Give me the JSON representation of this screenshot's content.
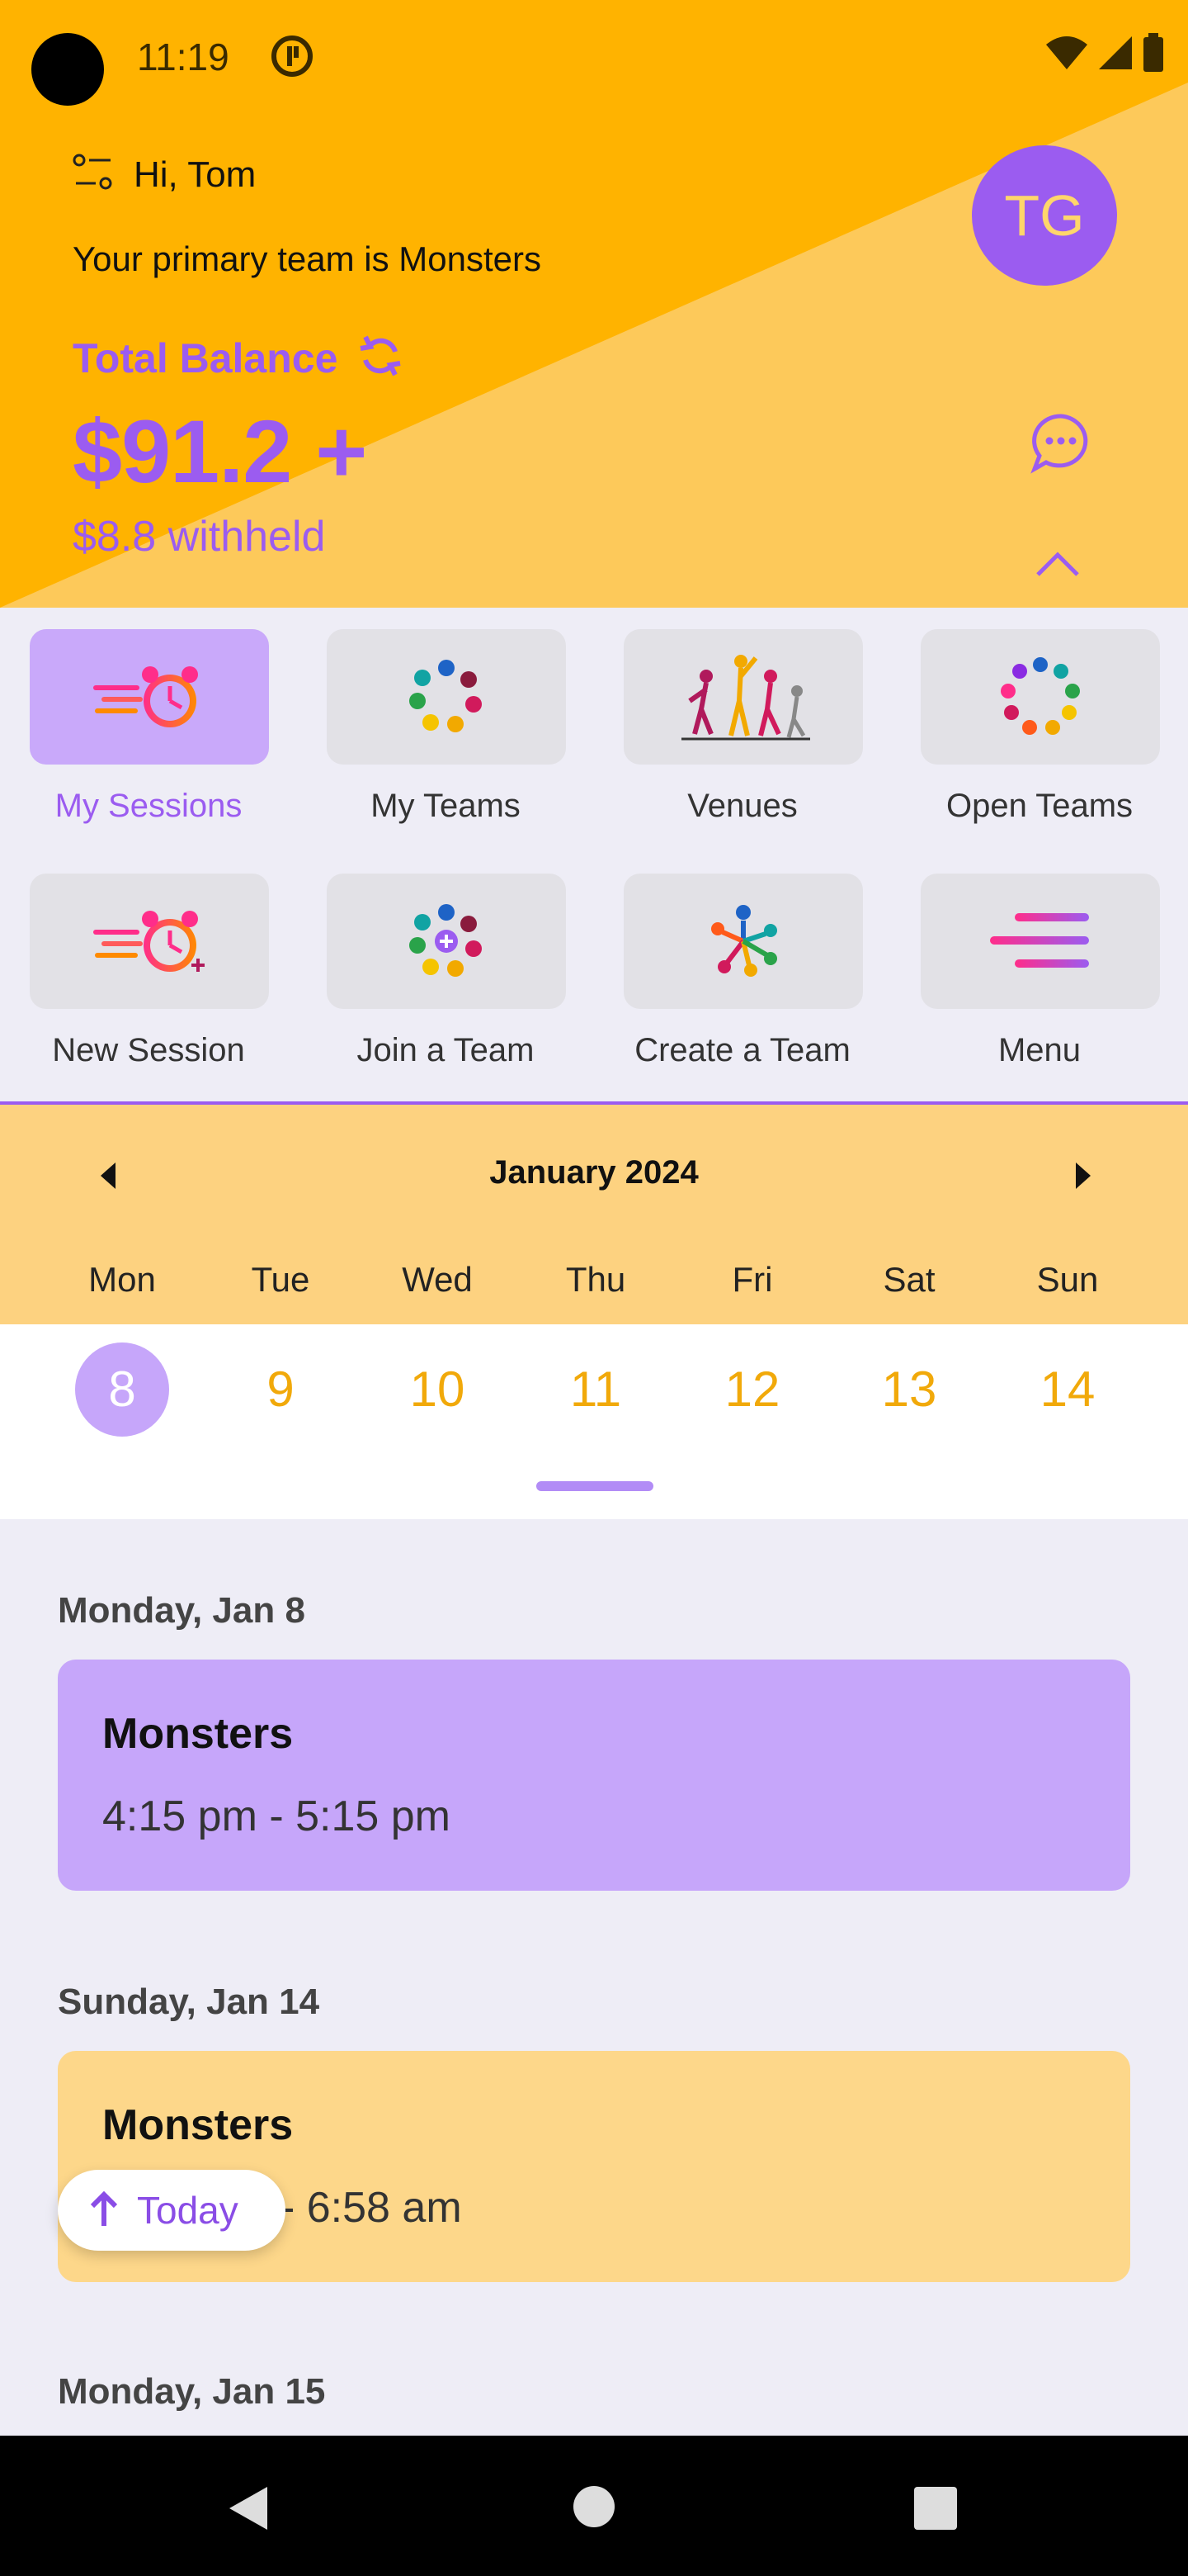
{
  "status": {
    "time": "11:19"
  },
  "header": {
    "greeting": "Hi, Tom",
    "primary_team": "Your primary team is Monsters",
    "total_balance_label": "Total Balance",
    "balance": "$91.2 +",
    "withheld": "$8.8 withheld",
    "avatar_initials": "TG"
  },
  "actions": [
    {
      "label": "My Sessions",
      "active": true
    },
    {
      "label": "My Teams"
    },
    {
      "label": "Venues"
    },
    {
      "label": "Open Teams"
    },
    {
      "label": "New Session"
    },
    {
      "label": "Join a Team"
    },
    {
      "label": "Create a Team"
    },
    {
      "label": "Menu"
    }
  ],
  "calendar": {
    "month": "January 2024",
    "weekdays": [
      "Mon",
      "Tue",
      "Wed",
      "Thu",
      "Fri",
      "Sat",
      "Sun"
    ],
    "days": [
      "8",
      "9",
      "10",
      "11",
      "12",
      "13",
      "14"
    ],
    "selected_day": "8"
  },
  "sessions": [
    {
      "date": "Monday, Jan 8",
      "team": "Monsters",
      "time": "4:15 pm - 5:15 pm"
    },
    {
      "date": "Sunday, Jan 14",
      "team": "Monsters",
      "time": "- 6:58 am"
    },
    {
      "date": "Monday, Jan 15"
    }
  ],
  "today_button": "Today",
  "colors": {
    "accent": "#9b5cf0",
    "header": "#ffb300",
    "gold": "#f1a90a"
  }
}
